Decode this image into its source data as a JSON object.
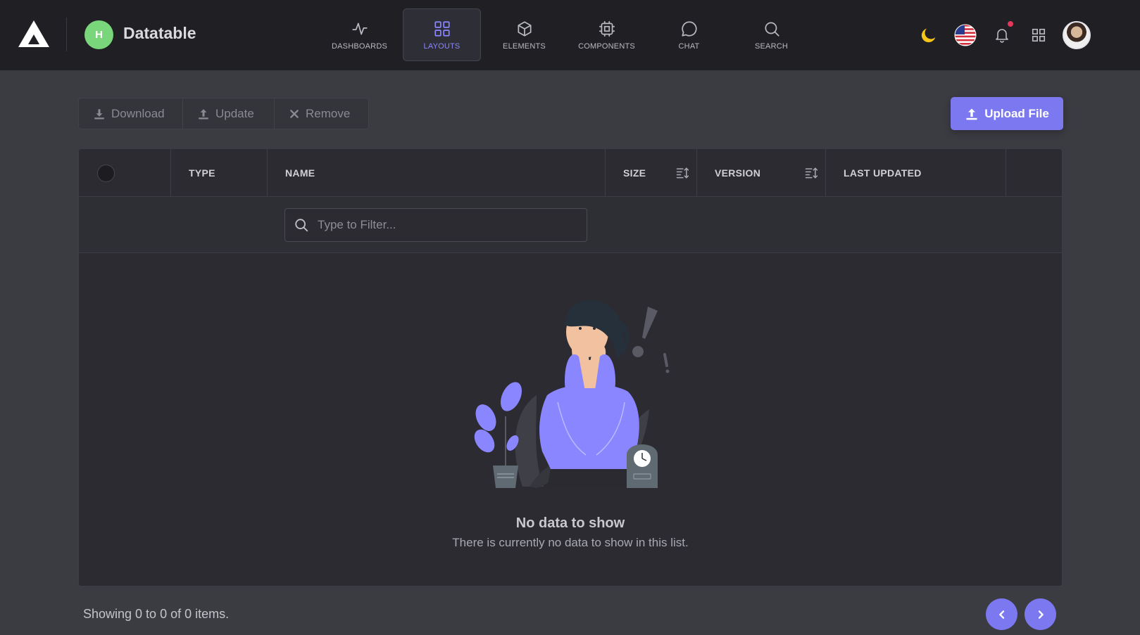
{
  "brand": {
    "avatar_initial": "H",
    "title": "Datatable"
  },
  "nav": [
    {
      "label": "DASHBOARDS",
      "icon": "activity-icon"
    },
    {
      "label": "LAYOUTS",
      "icon": "grid-icon",
      "active": true
    },
    {
      "label": "ELEMENTS",
      "icon": "cube-icon"
    },
    {
      "label": "COMPONENTS",
      "icon": "cpu-icon"
    },
    {
      "label": "CHAT",
      "icon": "chat-bubble-icon"
    },
    {
      "label": "SEARCH",
      "icon": "search-icon"
    }
  ],
  "tools": [
    "moon-icon",
    "us-flag-icon",
    "bell-icon",
    "apps-grid-icon",
    "avatar"
  ],
  "actions": {
    "download": "Download",
    "update": "Update",
    "remove": "Remove",
    "upload": "Upload File"
  },
  "table": {
    "columns": [
      "TYPE",
      "NAME",
      "SIZE",
      "VERSION",
      "LAST UPDATED"
    ],
    "filter_placeholder": "Type to Filter...",
    "empty_title": "No data to show",
    "empty_subtitle": "There is currently no data to show in this list."
  },
  "footer": {
    "showing": "Showing 0 to 0 of 0 items."
  },
  "colors": {
    "accent": "#7b78f0",
    "topbar": "#1f1f24",
    "background": "#3b3b42",
    "notification": "#e3385b",
    "brand_avatar": "#79d67a"
  }
}
